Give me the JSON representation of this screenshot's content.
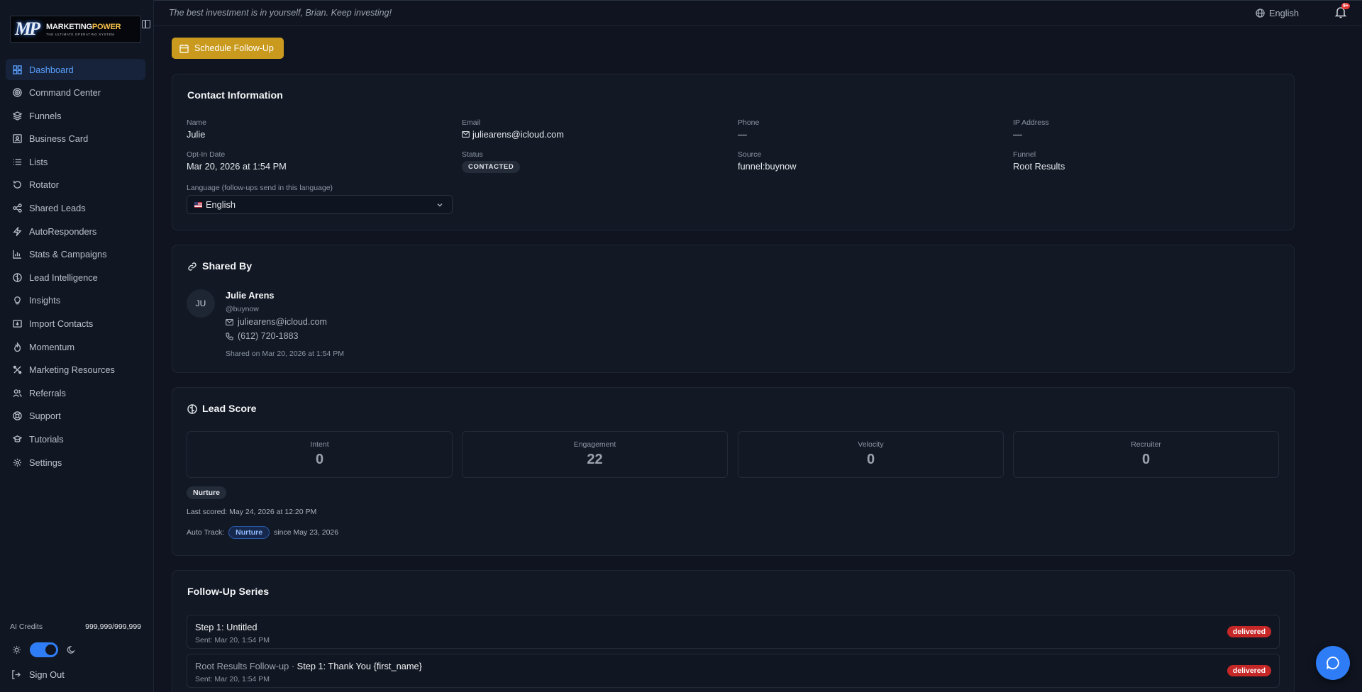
{
  "brand": {
    "logo_word_a": "MARKETING",
    "logo_word_b": "POWER",
    "logo_tag": "THE ULTIMATE OPERATING SYSTEM"
  },
  "sidebar": {
    "items": [
      {
        "label": "Dashboard",
        "icon": "dashboard-icon",
        "active": true
      },
      {
        "label": "Command Center",
        "icon": "target-icon"
      },
      {
        "label": "Funnels",
        "icon": "layers-icon"
      },
      {
        "label": "Business Card",
        "icon": "id-card-icon"
      },
      {
        "label": "Lists",
        "icon": "list-icon"
      },
      {
        "label": "Rotator",
        "icon": "rotate-icon"
      },
      {
        "label": "Shared Leads",
        "icon": "share-icon"
      },
      {
        "label": "AutoResponders",
        "icon": "zap-icon"
      },
      {
        "label": "Stats & Campaigns",
        "icon": "bar-chart-icon"
      },
      {
        "label": "Lead Intelligence",
        "icon": "brain-icon"
      },
      {
        "label": "Insights",
        "icon": "lightbulb-icon"
      },
      {
        "label": "Import Contacts",
        "icon": "import-icon"
      },
      {
        "label": "Momentum",
        "icon": "flame-icon"
      },
      {
        "label": "Marketing Resources",
        "icon": "tools-icon"
      },
      {
        "label": "Referrals",
        "icon": "users-icon"
      },
      {
        "label": "Support",
        "icon": "lifebuoy-icon"
      },
      {
        "label": "Tutorials",
        "icon": "graduation-cap-icon"
      },
      {
        "label": "Settings",
        "icon": "gear-icon"
      }
    ],
    "credits_label": "AI Credits",
    "credits_value": "999,999/999,999",
    "sign_out": "Sign Out"
  },
  "topbar": {
    "quote": "The best investment is in yourself, Brian. Keep investing!",
    "language": "English",
    "notification_badge": "9+"
  },
  "actions": {
    "schedule_follow_up": "Schedule Follow-Up"
  },
  "contact": {
    "title": "Contact Information",
    "name_label": "Name",
    "name": "Julie",
    "email_label": "Email",
    "email": "juliearens@icloud.com",
    "phone_label": "Phone",
    "phone": "—",
    "ip_label": "IP Address",
    "ip": "—",
    "optin_label": "Opt-In Date",
    "optin": "Mar 20, 2026 at 1:54 PM",
    "status_label": "Status",
    "status": "CONTACTED",
    "source_label": "Source",
    "source": "funnel:buynow",
    "funnel_label": "Funnel",
    "funnel": "Root Results",
    "language_label": "Language (follow-ups send in this language)",
    "language_value": "English"
  },
  "shared_by": {
    "title": "Shared By",
    "initials": "JU",
    "name": "Julie Arens",
    "handle": "@buynow",
    "email": "juliearens@icloud.com",
    "phone": "(612) 720-1883",
    "shared_on": "Shared on Mar 20, 2026 at 1:54 PM"
  },
  "lead_score": {
    "title": "Lead Score",
    "metrics": [
      {
        "label": "Intent",
        "value": "0"
      },
      {
        "label": "Engagement",
        "value": "22"
      },
      {
        "label": "Velocity",
        "value": "0"
      },
      {
        "label": "Recruiter",
        "value": "0"
      }
    ],
    "tag": "Nurture",
    "last_scored": "Last scored: May 24, 2026 at 12:20 PM",
    "auto_track_label": "Auto Track:",
    "auto_track_value": "Nurture",
    "auto_track_since": "since May 23, 2026"
  },
  "follow_up": {
    "title": "Follow-Up Series",
    "steps": [
      {
        "prefix": "",
        "title": "Step 1: Untitled",
        "sent": "Sent: Mar 20, 1:54 PM",
        "status": "delivered"
      },
      {
        "prefix": "Root Results Follow-up · ",
        "title": "Step 1: Thank You {first_name}",
        "sent": "Sent: Mar 20, 1:54 PM",
        "status": "delivered"
      }
    ]
  },
  "colors": {
    "accent": "#2f7df6",
    "button": "#c99a1d",
    "danger": "#c62828",
    "background": "#0f1420"
  }
}
